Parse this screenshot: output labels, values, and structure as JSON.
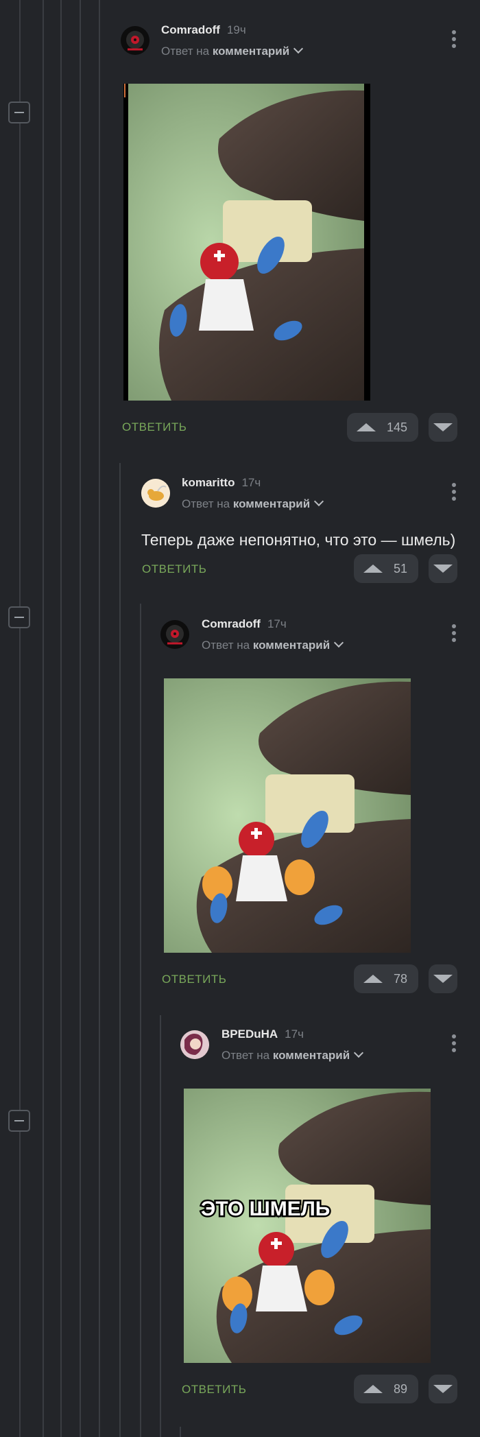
{
  "thread": {
    "reply_label": "ОТВЕТИТЬ",
    "reply_to_prefix": "Ответ на",
    "reply_to_target": "комментарий"
  },
  "comments": [
    {
      "author": "Comradoff",
      "time": "19ч",
      "upvotes": "145"
    },
    {
      "author": "komaritto",
      "time": "17ч",
      "text": "Теперь даже непонятно, что это — шмель)",
      "upvotes": "51"
    },
    {
      "author": "Comradoff",
      "time": "17ч",
      "upvotes": "78"
    },
    {
      "author": "BPEDuHA",
      "time": "17ч",
      "upvotes": "89",
      "image_caption": "ЭТО ШМЕЛЬ"
    }
  ],
  "colors": {
    "background": "#232529",
    "reply_green": "#79a85a",
    "vote_bg": "#35383d"
  }
}
